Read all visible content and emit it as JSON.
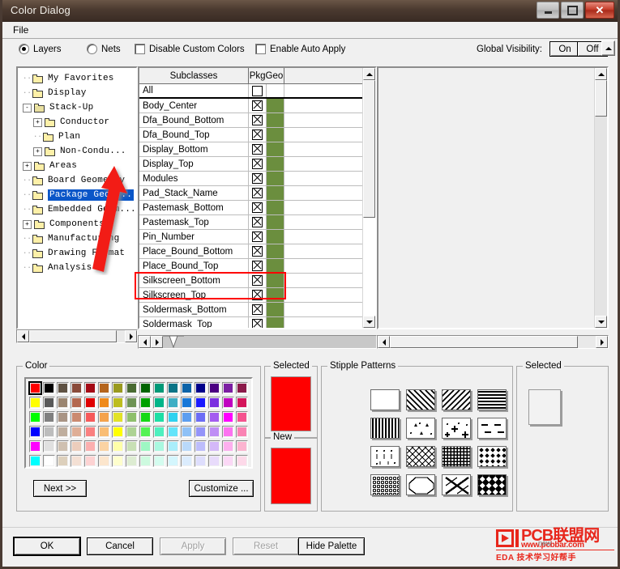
{
  "window": {
    "title": "Color Dialog",
    "buttons": {
      "minimize": "–",
      "maximize": "□",
      "close": "✕"
    }
  },
  "menubar": {
    "items": [
      "File"
    ]
  },
  "options": {
    "layers_label": "Layers",
    "nets_label": "Nets",
    "disable_custom_colors_label": "Disable Custom Colors",
    "enable_auto_apply_label": "Enable Auto Apply",
    "global_visibility_label": "Global Visibility:",
    "on_label": "On",
    "off_label": "Off"
  },
  "tree": {
    "items": [
      {
        "label": "My Favorites",
        "depth": 1,
        "expander": "",
        "selected": false
      },
      {
        "label": "Display",
        "depth": 1,
        "expander": "",
        "selected": false
      },
      {
        "label": "Stack-Up",
        "depth": 1,
        "expander": "-",
        "selected": false,
        "open": true
      },
      {
        "label": "Conductor",
        "depth": 2,
        "expander": "+",
        "selected": false
      },
      {
        "label": "Plan",
        "depth": 2,
        "expander": "",
        "selected": false
      },
      {
        "label": "Non-Condu...",
        "depth": 2,
        "expander": "+",
        "selected": false
      },
      {
        "label": "Areas",
        "depth": 1,
        "expander": "+",
        "selected": false
      },
      {
        "label": "Board Geometry",
        "depth": 1,
        "expander": "",
        "selected": false
      },
      {
        "label": "Package Geom...",
        "depth": 1,
        "expander": "",
        "selected": true
      },
      {
        "label": "Embedded Geom...",
        "depth": 1,
        "expander": "",
        "selected": false
      },
      {
        "label": "Components",
        "depth": 1,
        "expander": "+",
        "selected": false
      },
      {
        "label": "Manufacturing",
        "depth": 1,
        "expander": "",
        "selected": false
      },
      {
        "label": "Drawing Format",
        "depth": 1,
        "expander": "",
        "selected": false
      },
      {
        "label": "Analysis",
        "depth": 1,
        "expander": "",
        "selected": false
      }
    ]
  },
  "subclasses": {
    "header": {
      "name": "Subclasses",
      "group": "PkgGeo"
    },
    "visibility_color": "#6b8e3e",
    "rows": [
      {
        "name": "All",
        "checked": false,
        "swatch": "#ffffff",
        "all_row": true
      },
      {
        "name": "Body_Center",
        "checked": true,
        "swatch": "#6b8e3e"
      },
      {
        "name": "Dfa_Bound_Bottom",
        "checked": true,
        "swatch": "#6b8e3e"
      },
      {
        "name": "Dfa_Bound_Top",
        "checked": true,
        "swatch": "#6b8e3e"
      },
      {
        "name": "Display_Bottom",
        "checked": true,
        "swatch": "#6b8e3e"
      },
      {
        "name": "Display_Top",
        "checked": true,
        "swatch": "#6b8e3e"
      },
      {
        "name": "Modules",
        "checked": true,
        "swatch": "#6b8e3e"
      },
      {
        "name": "Pad_Stack_Name",
        "checked": true,
        "swatch": "#6b8e3e"
      },
      {
        "name": "Pastemask_Bottom",
        "checked": true,
        "swatch": "#6b8e3e"
      },
      {
        "name": "Pastemask_Top",
        "checked": true,
        "swatch": "#6b8e3e"
      },
      {
        "name": "Pin_Number",
        "checked": true,
        "swatch": "#6b8e3e"
      },
      {
        "name": "Place_Bound_Bottom",
        "checked": true,
        "swatch": "#6b8e3e"
      },
      {
        "name": "Place_Bound_Top",
        "checked": true,
        "swatch": "#6b8e3e"
      },
      {
        "name": "Silkscreen_Bottom",
        "checked": true,
        "swatch": "#6b8e3e",
        "highlighted": true
      },
      {
        "name": "Silkscreen_Top",
        "checked": true,
        "swatch": "#6b8e3e",
        "highlighted": true
      },
      {
        "name": "Soldermask_Bottom",
        "checked": true,
        "swatch": "#6b8e3e"
      },
      {
        "name": "Soldermask_Top",
        "checked": true,
        "swatch": "#6b8e3e"
      }
    ]
  },
  "color_group": {
    "legend": "Color",
    "next_label": "Next >>",
    "customize_label": "Customize ...",
    "selected_index": 0,
    "palette": [
      [
        "#ff0000",
        "#000000",
        "#5f5243",
        "#8a4b3a",
        "#a50b16",
        "#b5651d",
        "#9a9a1e",
        "#496b32",
        "#006400",
        "#009977",
        "#0a7487",
        "#0b63a8",
        "#00008b",
        "#4b0082",
        "#7b1fa2",
        "#8b1a4a"
      ],
      [
        "#ffff00",
        "#595959",
        "#9b8570",
        "#b4684f",
        "#e00000",
        "#ef8a1a",
        "#bdbd1e",
        "#6f9455",
        "#00a000",
        "#00b589",
        "#3eaec4",
        "#1878d8",
        "#1a1aff",
        "#7b2fe0",
        "#c000c0",
        "#d4145a"
      ],
      [
        "#00ff00",
        "#808080",
        "#a99484",
        "#cb8a70",
        "#f75a5a",
        "#f5a34c",
        "#e2e228",
        "#8fc06c",
        "#16d916",
        "#1ddfa5",
        "#2fd2f0",
        "#5c9ef0",
        "#6c6cf5",
        "#a45cf0",
        "#ff00ff",
        "#f5538f"
      ],
      [
        "#0000ff",
        "#bdbdbd",
        "#bfae9e",
        "#dfae96",
        "#fa8080",
        "#f9bd74",
        "#ffff00",
        "#aed394",
        "#53f253",
        "#4ef0bf",
        "#63e4fa",
        "#8ec1f7",
        "#9494f9",
        "#bf8ef5",
        "#fc72f0",
        "#fa83b4"
      ],
      [
        "#ff00ff",
        "#e0e0e0",
        "#cfc0b0",
        "#eccdbc",
        "#fcafaf",
        "#fbd3a3",
        "#ffffa8",
        "#c8e0b5",
        "#9ef7c3",
        "#aaf8e0",
        "#a9eefb",
        "#b9d9fa",
        "#bdbdfb",
        "#d4b8f8",
        "#fdafee",
        "#fcb4d0"
      ],
      [
        "#00ffff",
        "#ffffff",
        "#ddd0bc",
        "#f4e0d4",
        "#fdd3d3",
        "#fce6cd",
        "#fefecd",
        "#ddecd2",
        "#cdfadf",
        "#d4fcef",
        "#d4f6fd",
        "#dbecfd",
        "#dedefd",
        "#e8dbfb",
        "#fbd8f6",
        "#fdd9e9"
      ]
    ]
  },
  "selected_color": {
    "legend": "Selected",
    "color": "#ff0000"
  },
  "new_color": {
    "legend": "New",
    "color": "#ff0000"
  },
  "stipple": {
    "legend": "Stipple Patterns",
    "patterns": [
      "solid-blank",
      "diagonal-lines-down",
      "diagonal-lines-up",
      "horizontal-lines",
      "vertical-lines",
      "triangles-dots",
      "plus-dots",
      "dashes",
      "ticks-dots",
      "cross-hatch-diagonal",
      "grid-mesh",
      "diamond-dots",
      "small-circles",
      "octagon-outline",
      "bow-tie-cross",
      "bold-diamonds"
    ],
    "selected_index": null
  },
  "stipple_selected": {
    "legend": "Selected"
  },
  "bottom_buttons": [
    {
      "label": "OK",
      "enabled": true,
      "default": true
    },
    {
      "label": "Cancel",
      "enabled": true,
      "default": false
    },
    {
      "label": "Apply",
      "enabled": false,
      "default": false
    },
    {
      "label": "Reset",
      "enabled": false,
      "default": false
    },
    {
      "label": "Hide Palette",
      "enabled": true,
      "default": false
    }
  ],
  "watermark": {
    "brand": "PCB联盟网",
    "url": "www.pcbbar.com",
    "tagline": "EDA 技术学习好帮手",
    "hint": "new"
  }
}
